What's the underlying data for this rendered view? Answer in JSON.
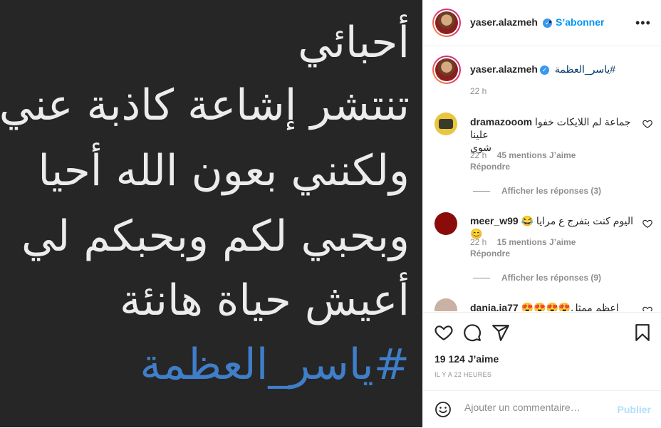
{
  "post_image": {
    "lines": [
      "أحبائي",
      "تنتشر إشاعة كاذبة عني",
      "ولكنني بعون الله أحيا",
      "وبحبي لكم وبحبكم لي",
      "أعيش حياة هانئة"
    ],
    "hashtag": "#ياسر_العظمة"
  },
  "header": {
    "username": "yaser.alazmeh",
    "separator": "•",
    "follow_label": "S’abonner",
    "more_icon": "more-options-icon"
  },
  "caption": {
    "username": "yaser.alazmeh",
    "text": "#ياسر_العظمة",
    "time": "22 h"
  },
  "comments": [
    {
      "username": "dramazooom",
      "text_line1": "جماعة لم اللايكات خفوا علينا",
      "text_line2": "شوي",
      "time": "22 h",
      "likes": "45 mentions J’aime",
      "reply_label": "Répondre",
      "show_replies": "Afficher les réponses (3)"
    },
    {
      "username": "meer_w99",
      "text": "اليوم كنت بتفرج ع مرايا 😂😊",
      "time": "22 h",
      "likes": "15 mentions J’aime",
      "reply_label": "Répondre",
      "show_replies": "Afficher les réponses (9)"
    },
    {
      "username": "dania.ja77",
      "text": "اعظم ممثل😍😍😍😍"
    }
  ],
  "actions": {
    "likes": "19 124 J’aime",
    "timestamp": "IL Y A 22 HEURES"
  },
  "add_comment": {
    "placeholder": "Ajouter un commentaire…",
    "publish_label": "Publier"
  },
  "colors": {
    "accent": "#0095f6",
    "publish_disabled": "#b2dffc",
    "verified": "#3897f0",
    "image_bg": "#262626",
    "hashtag_text": "#3f7ec9"
  }
}
